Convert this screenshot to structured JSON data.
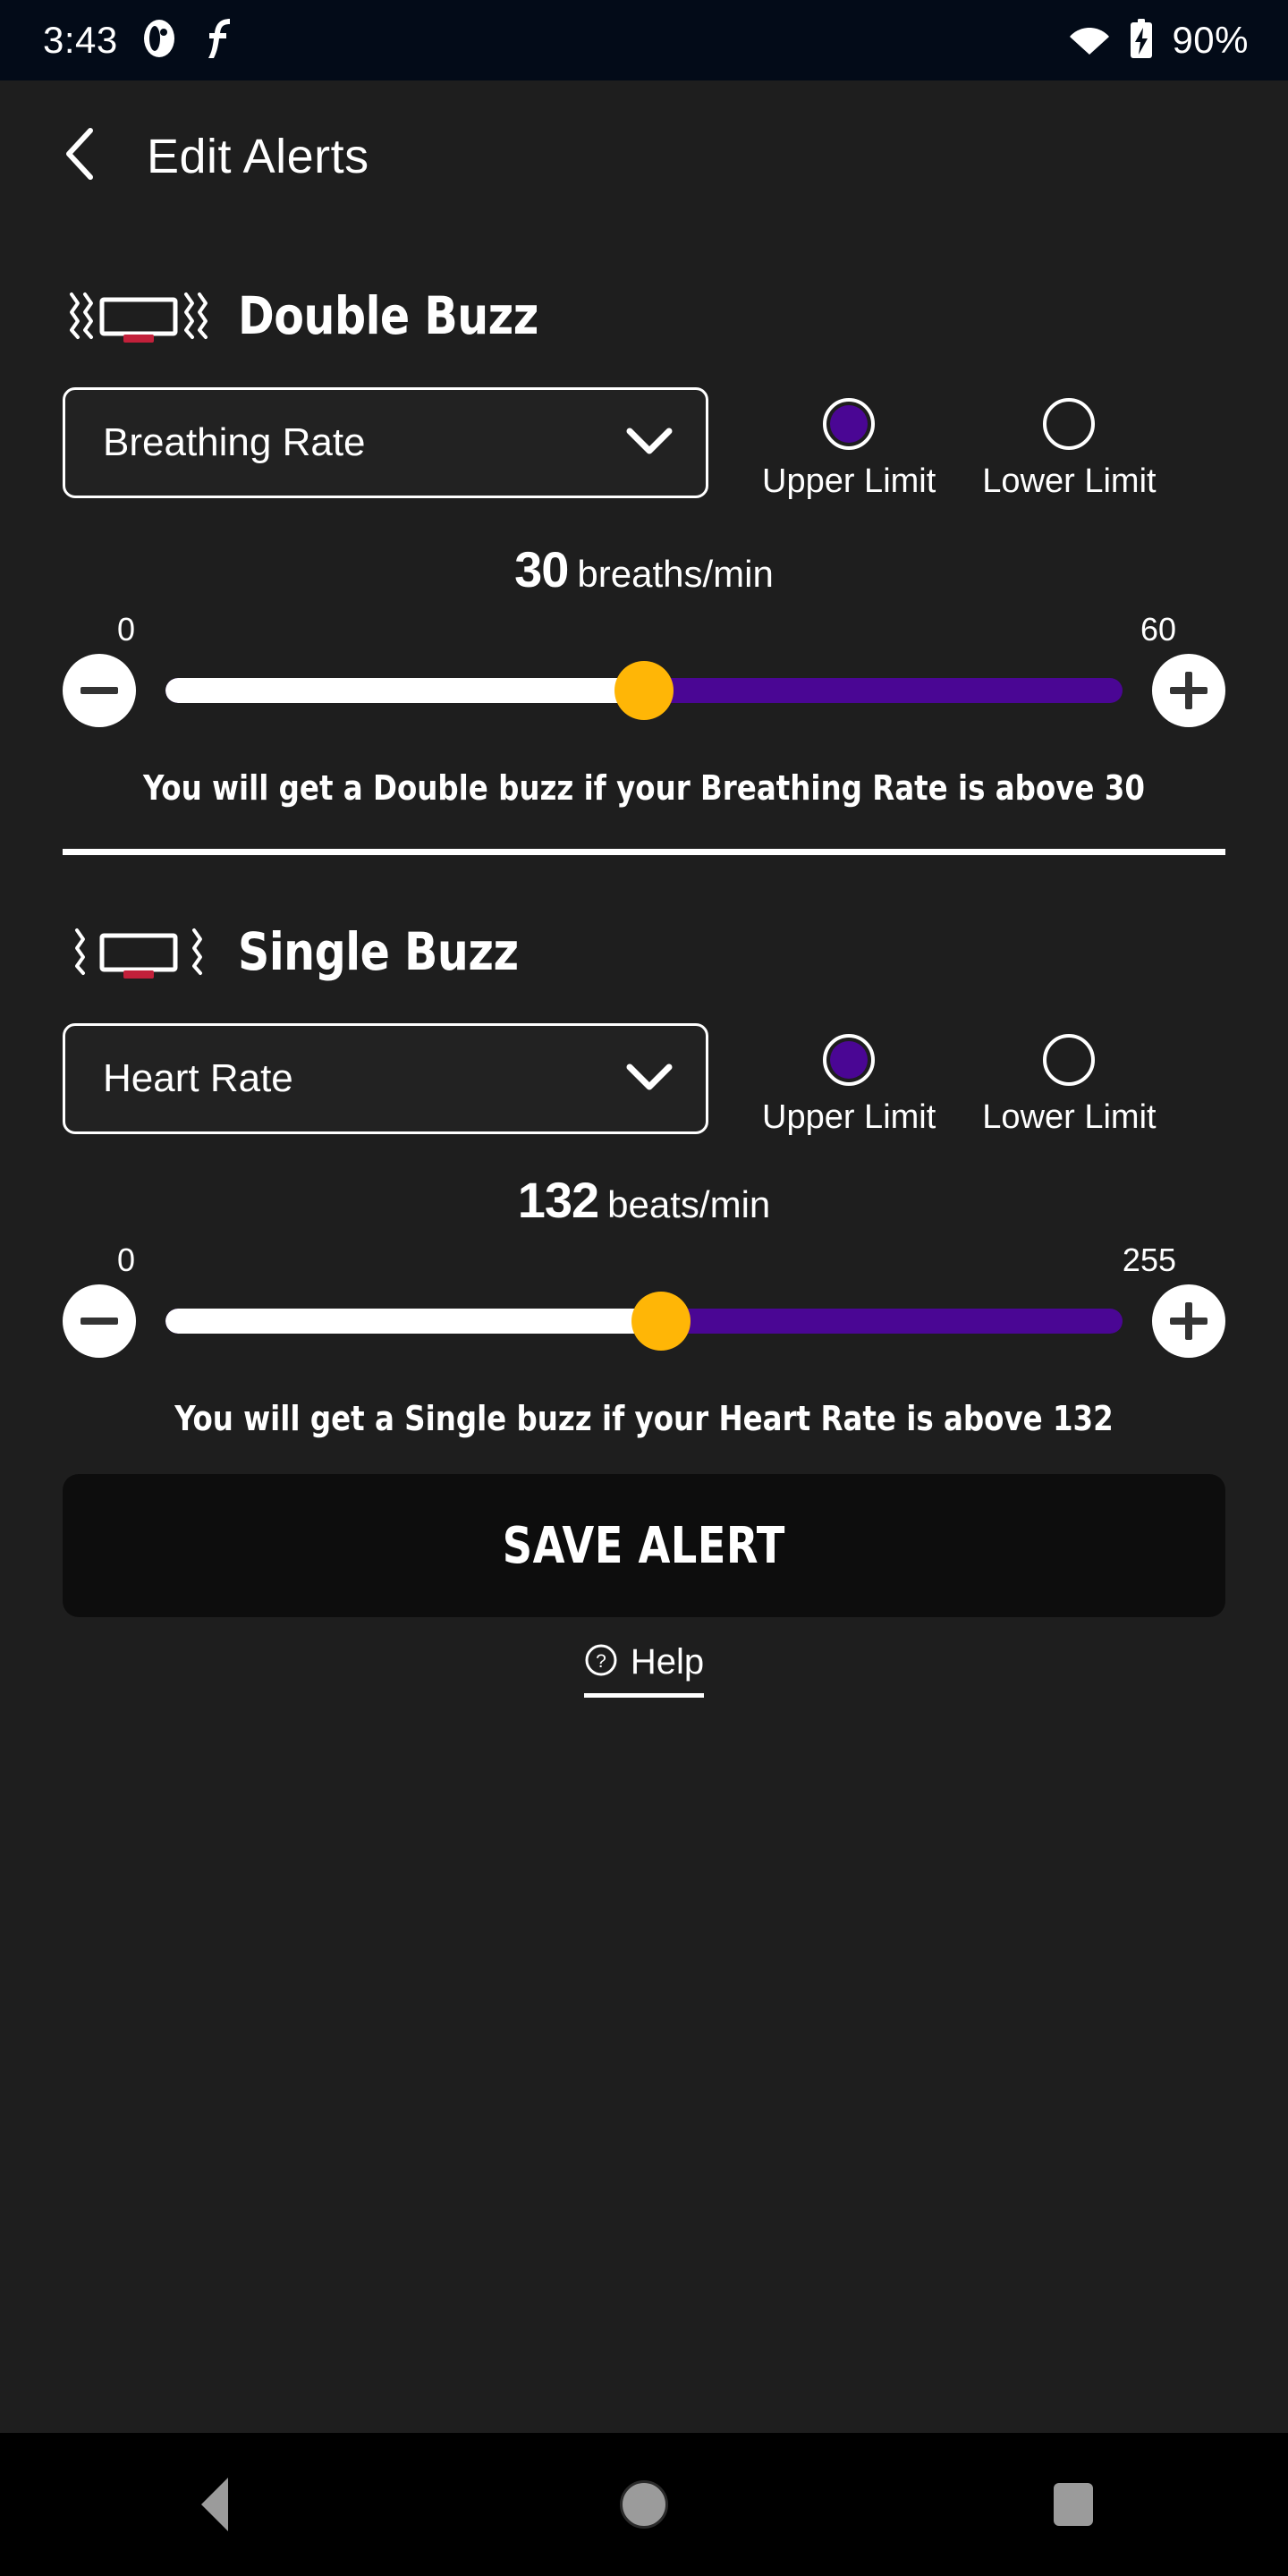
{
  "status_bar": {
    "time": "3:43",
    "battery_percent": "90%",
    "icons": [
      "ghost-app-icon",
      "script-f-app-icon",
      "wifi-icon",
      "battery-charging-icon"
    ],
    "background_color": "#030b18"
  },
  "app_bar": {
    "back_icon": "chevron-left-icon",
    "title": "Edit Alerts"
  },
  "theme": {
    "background": "#1e1e1e",
    "accent_purple": "#4a0694",
    "thumb_amber": "#ffb606",
    "text": "#ffffff",
    "vibration_red": "#c2203a",
    "save_button_bg": "#0d0d0d"
  },
  "sections": [
    {
      "id": "double-buzz",
      "icon": "vibration-double-icon",
      "title": "Double Buzz",
      "dropdown": {
        "value": "Breathing Rate",
        "chevron_icon": "chevron-down-icon"
      },
      "limits": [
        {
          "label": "Upper Limit",
          "selected": true
        },
        {
          "label": "Lower Limit",
          "selected": false
        }
      ],
      "readout": {
        "number": "30",
        "unit": "breaths/min"
      },
      "slider": {
        "min_label": "0",
        "max_label": "60",
        "min": 0,
        "max": 60,
        "value": 30,
        "fill_percent": 50,
        "decrement_icon": "minus-icon",
        "increment_icon": "plus-icon"
      },
      "description": "You will get a Double buzz if your Breathing Rate is above 30"
    },
    {
      "id": "single-buzz",
      "icon": "vibration-single-icon",
      "title": "Single Buzz",
      "dropdown": {
        "value": "Heart Rate",
        "chevron_icon": "chevron-down-icon"
      },
      "limits": [
        {
          "label": "Upper Limit",
          "selected": true
        },
        {
          "label": "Lower Limit",
          "selected": false
        }
      ],
      "readout": {
        "number": "132",
        "unit": "beats/min"
      },
      "slider": {
        "min_label": "0",
        "max_label": "255",
        "min": 0,
        "max": 255,
        "value": 132,
        "fill_percent": 51.8,
        "decrement_icon": "minus-icon",
        "increment_icon": "plus-icon"
      },
      "description": "You will get a Single buzz if your Heart Rate is above 132"
    }
  ],
  "save_button": {
    "label": "SAVE ALERT"
  },
  "help": {
    "icon": "question-circle-icon",
    "label": "Help"
  },
  "nav_bar": {
    "back": "nav-back-icon",
    "home": "nav-home-icon",
    "recents": "nav-recents-icon"
  }
}
